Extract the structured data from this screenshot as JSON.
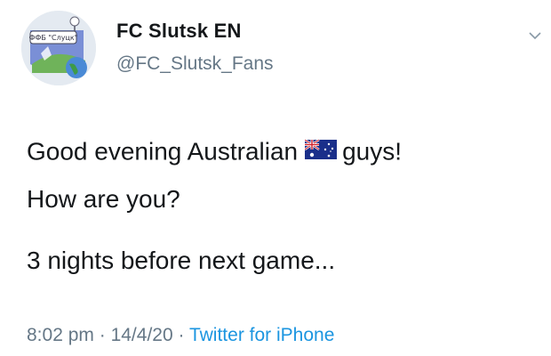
{
  "account": {
    "display_name": "FC Slutsk EN",
    "handle": "@FC_Slutsk_Fans",
    "avatar_banner_text": "ФФБ \"Слуцк\""
  },
  "tweet": {
    "line1_before_flag": "Good evening Australian",
    "flag_icon": "australia-flag-icon",
    "line1_after_flag": "guys!",
    "line2": "How are you?",
    "line3": "3 nights before next game..."
  },
  "meta": {
    "time": "8:02 pm",
    "separator": "·",
    "date": "14/4/20",
    "source": "Twitter for iPhone"
  },
  "colors": {
    "text": "#14171a",
    "secondary": "#657786",
    "link": "#1b95e0"
  }
}
